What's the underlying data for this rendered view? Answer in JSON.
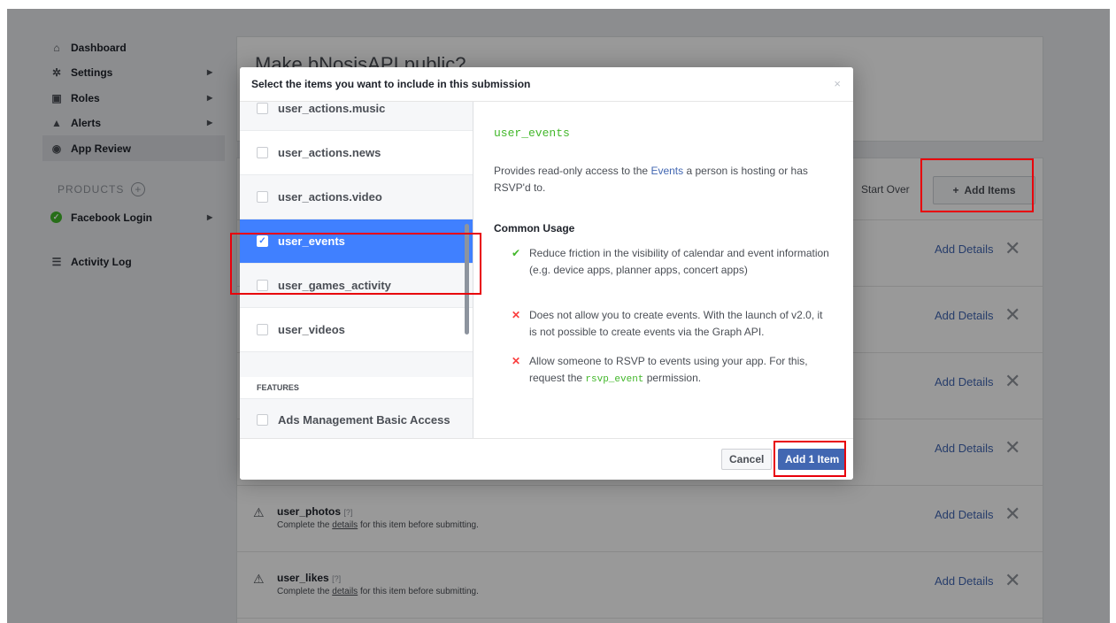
{
  "sidebar": {
    "items": [
      {
        "label": "Dashboard",
        "icon": "home-icon",
        "glyph": "🏠"
      },
      {
        "label": "Settings",
        "icon": "gear-icon",
        "glyph": "⚙"
      },
      {
        "label": "Roles",
        "icon": "roles-icon",
        "glyph": "▣"
      },
      {
        "label": "Alerts",
        "icon": "bell-icon",
        "glyph": "🔔"
      },
      {
        "label": "App Review",
        "icon": "eye-icon",
        "glyph": "◉"
      }
    ],
    "products_label": "PRODUCTS",
    "products_add": "+",
    "facebook_login": "Facebook Login",
    "activity_log": "Activity Log",
    "activity_glyph": "☰"
  },
  "page": {
    "title": "Make bNosisAPI public?",
    "start_over": "Start Over",
    "add_items": "Add Items",
    "add_details": "Add Details",
    "rows": [
      {
        "title": "user_photos",
        "help": "[?]",
        "sub_pre": "Complete the",
        "sub_link": "details",
        "sub_post": "for this item before submitting."
      },
      {
        "title": "user_likes",
        "help": "[?]",
        "sub_pre": "Complete the",
        "sub_link": "details",
        "sub_post": "for this item before submitting."
      }
    ]
  },
  "modal": {
    "title": "Select the items you want to include in this submission",
    "close": "×",
    "items": [
      {
        "label": "user_actions.music",
        "checked": false
      },
      {
        "label": "user_actions.news",
        "checked": false
      },
      {
        "label": "user_actions.video",
        "checked": false
      },
      {
        "label": "user_events",
        "checked": true
      },
      {
        "label": "user_games_activity",
        "checked": false
      },
      {
        "label": "user_videos",
        "checked": false
      }
    ],
    "features_header": "FEATURES",
    "feature_item": "Ads Management Basic Access",
    "detail": {
      "name": "user_events",
      "desc_pre": "Provides read-only access to the",
      "desc_link": "Events",
      "desc_post": "a person is hosting or has RSVP'd to.",
      "common_usage": "Common Usage",
      "usage": [
        {
          "type": "yes",
          "text": "Reduce friction in the visibility of calendar and event information (e.g. device apps, planner apps, concert apps)"
        },
        {
          "type": "no",
          "text": "Does not allow you to create events. With the launch of v2.0, it is not possible to create events via the Graph API."
        },
        {
          "type": "no",
          "pre": "Allow someone to RSVP to events using your app. For this, request the",
          "code": "rsvp_event",
          "post": "permission."
        }
      ]
    },
    "cancel": "Cancel",
    "add": "Add 1 Item"
  },
  "colors": {
    "accent": "#4267b2",
    "selected": "#4080ff",
    "highlight": "#e8000b",
    "code": "#42b72a"
  }
}
